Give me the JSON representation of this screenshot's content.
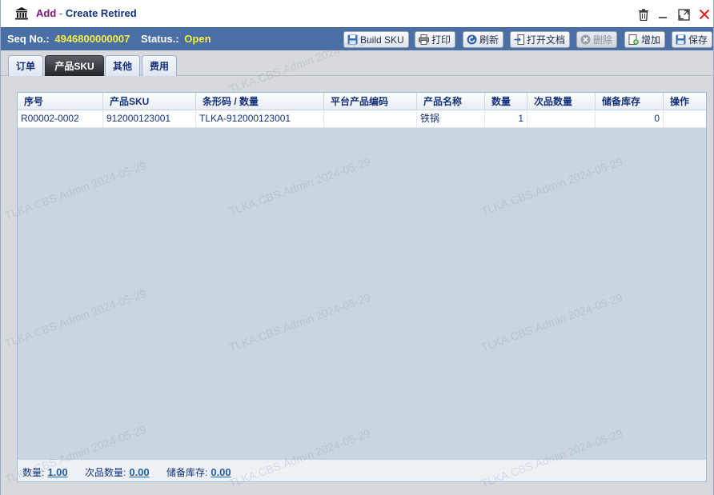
{
  "window": {
    "title_add": "Add",
    "title_sep": " - ",
    "title_main": "Create Retired"
  },
  "info": {
    "seq_label": "Seq No.:",
    "seq_value": "4946800000007",
    "status_label": "Status.:",
    "status_value": "Open"
  },
  "toolbar": {
    "build_sku": "Build SKU",
    "print": "打印",
    "refresh": "刷新",
    "open_doc": "打开文档",
    "delete": "删除",
    "add": "增加",
    "save": "保存"
  },
  "tabs": [
    {
      "label": "订单"
    },
    {
      "label": "产品SKU"
    },
    {
      "label": "其他"
    },
    {
      "label": "费用"
    }
  ],
  "grid": {
    "columns": [
      "序号",
      "产品SKU",
      "条形码 / 数量",
      "平台产品编码",
      "产品名称",
      "数量",
      "次品数量",
      "储备库存",
      "操作"
    ],
    "rows": [
      {
        "seq": "R00002-0002",
        "sku": "912000123001",
        "barcode": "TLKA-912000123001",
        "platform_code": "",
        "name": "铁锅",
        "qty": "1",
        "defect_qty": "",
        "reserve": "0",
        "action": ""
      }
    ]
  },
  "footer": {
    "qty_label": "数量:",
    "qty_value": "1.00",
    "defect_label": "次品数量:",
    "defect_value": "0.00",
    "reserve_label": "储备库存:",
    "reserve_value": "0.00"
  },
  "watermark": "TLKA.CBS.Admin 2024-05-29",
  "colors": {
    "header_bar": "#4a6fa5",
    "status_value": "#f5ee45",
    "title_add": "#7a1780",
    "close_icon": "#d9251d"
  }
}
